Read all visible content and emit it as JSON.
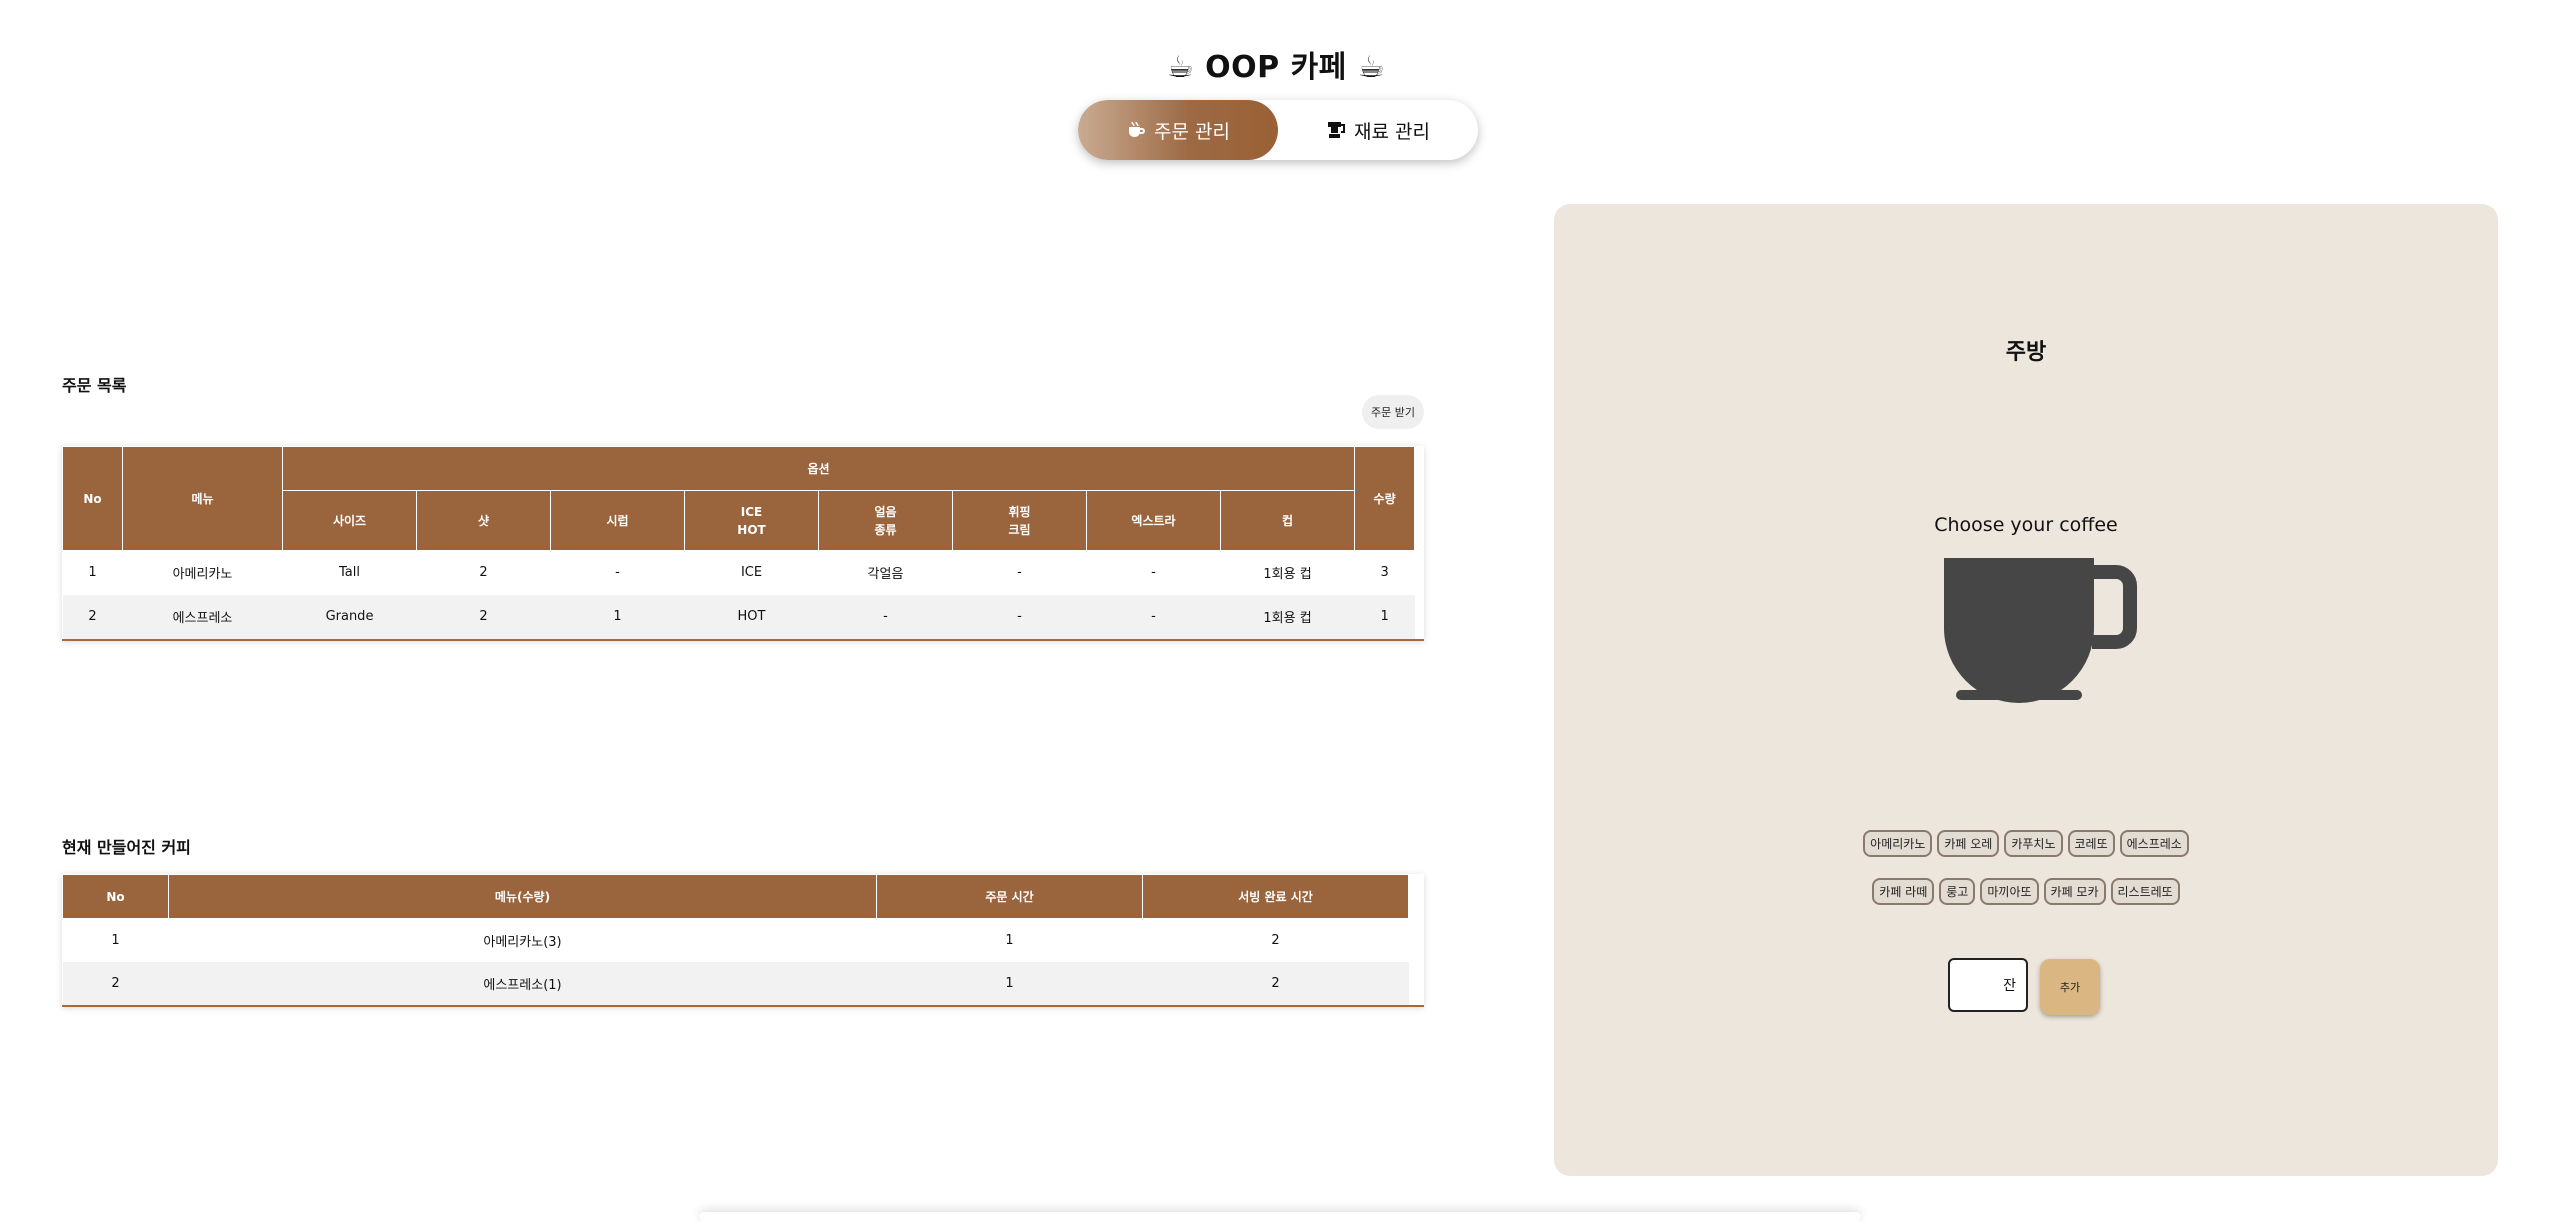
{
  "app": {
    "title_icon": "☕",
    "title": "OOP 카페"
  },
  "tabs": [
    {
      "label": "주문 관리",
      "icon": "coffee-icon",
      "active": true
    },
    {
      "label": "재료 관리",
      "icon": "grinder-icon",
      "active": false
    }
  ],
  "orders": {
    "title": "주문 목록",
    "receive_button": "주문 받기",
    "headers": {
      "no": "No",
      "menu": "메뉴",
      "options": "옵션",
      "size": "사이즈",
      "shot": "샷",
      "syrup": "시럽",
      "ice_hot_1": "ICE",
      "ice_hot_2": "HOT",
      "ice_type_1": "얼음",
      "ice_type_2": "종류",
      "whip_1": "휘핑",
      "whip_2": "크림",
      "extra": "엑스트라",
      "cup": "컵",
      "qty": "수량"
    },
    "rows": [
      {
        "no": "1",
        "menu": "아메리카노",
        "size": "Tall",
        "shot": "2",
        "syrup": "-",
        "ice_hot": "ICE",
        "ice_type": "각얼음",
        "whip": "-",
        "extra": "-",
        "cup": "1회용 컵",
        "qty": "3"
      },
      {
        "no": "2",
        "menu": "에스프레소",
        "size": "Grande",
        "shot": "2",
        "syrup": "1",
        "ice_hot": "HOT",
        "ice_type": "-",
        "whip": "-",
        "extra": "-",
        "cup": "1회용 컵",
        "qty": "1"
      }
    ]
  },
  "made": {
    "title": "현재 만들어진 커피",
    "headers": {
      "no": "No",
      "menu": "메뉴(수량)",
      "order_time": "주문 시간",
      "serve_time": "서빙 완료 시간"
    },
    "rows": [
      {
        "no": "1",
        "menu": "아메리카노(3)",
        "order_time": "1",
        "serve_time": "2"
      },
      {
        "no": "2",
        "menu": "에스프레소(1)",
        "order_time": "1",
        "serve_time": "2"
      }
    ]
  },
  "kitchen": {
    "title": "주방",
    "choose_label": "Choose your coffee",
    "cup_color": "#464646",
    "coffee_row1": [
      "아메리카노",
      "카페 오레",
      "카푸치노",
      "코레또",
      "에스프레소"
    ],
    "coffee_row2": [
      "카페 라떼",
      "룽고",
      "마끼아또",
      "카페 모카",
      "리스트레또"
    ],
    "qty_unit": "잔",
    "add_button": "추가"
  },
  "colors": {
    "accent": "#9a643c",
    "panel": "#ede6dd",
    "add_button": "#d9b682"
  }
}
